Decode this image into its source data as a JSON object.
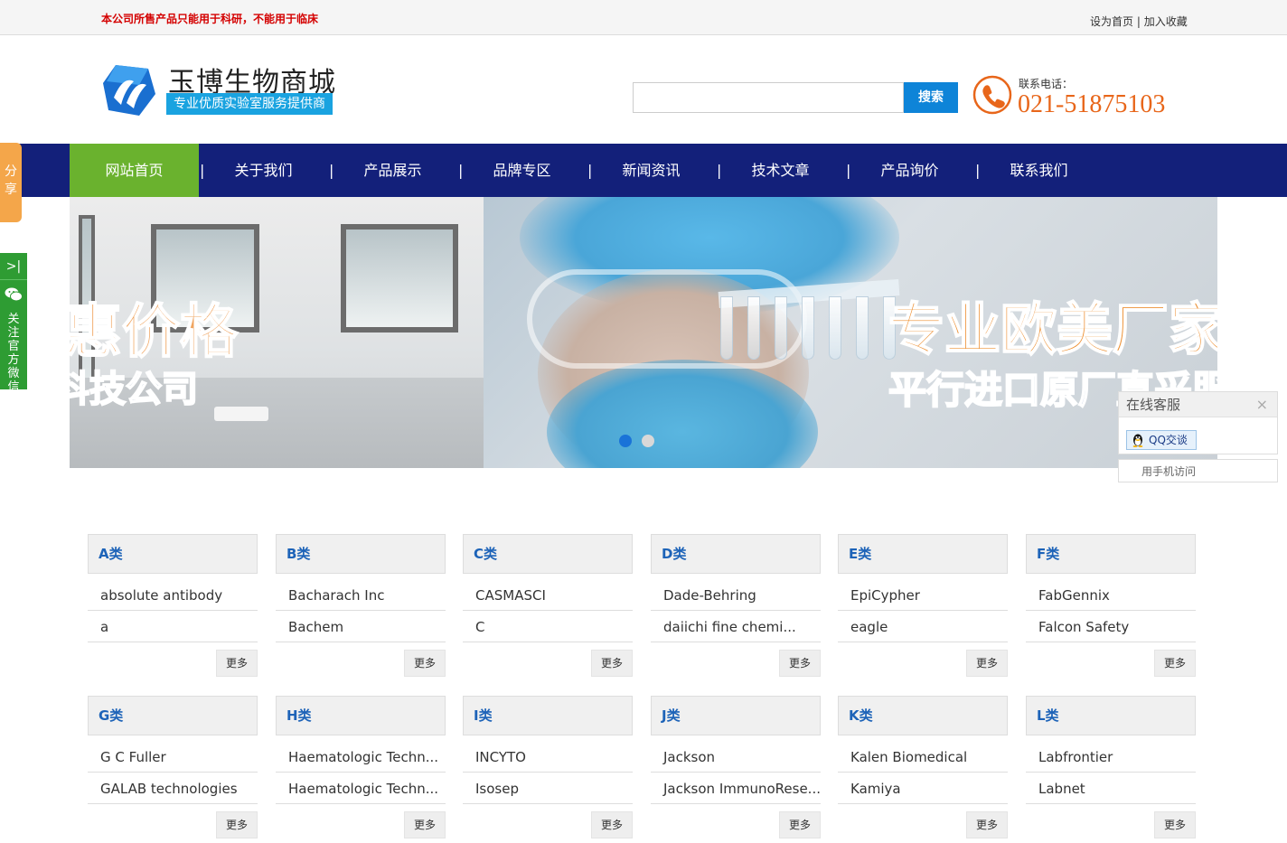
{
  "topbar": {
    "notice": "本公司所售产品只能用于科研，不能用于临床",
    "set_home": "设为首页",
    "separator": "|",
    "add_favorite": "加入收藏"
  },
  "header": {
    "logo_title": "玉博生物商城",
    "logo_slogan": "专业优质实验室服务提供商",
    "search_placeholder": "",
    "search_button": "搜索",
    "phone_label": "联系电话：",
    "phone_number": "021-51875103"
  },
  "nav": {
    "items": [
      "网站首页",
      "关于我们",
      "产品展示",
      "品牌专区",
      "新闻资讯",
      "技术文章",
      "产品询价",
      "联系我们"
    ],
    "separator": "|",
    "active_index": 0
  },
  "banner": {
    "left_line1": "惠价格",
    "left_line2": "科技公司",
    "right_line1": "专业欧美厂家",
    "right_line2": "平行进口原厂直采服",
    "slide_count": 2,
    "active_slide": 0
  },
  "sidebar": {
    "share_label": "分享",
    "wechat_arrow": ">|",
    "wechat_label": "关注官方微信"
  },
  "customer_service": {
    "title": "在线客服",
    "close": "×",
    "qq_button": "QQ交谈",
    "mobile_link": "用手机访问"
  },
  "categories": [
    {
      "title": "A类",
      "items": [
        "absolute antibody",
        "a"
      ],
      "more": "更多"
    },
    {
      "title": "B类",
      "items": [
        "Bacharach Inc",
        "Bachem"
      ],
      "more": "更多"
    },
    {
      "title": "C类",
      "items": [
        "CASMASCI",
        "C"
      ],
      "more": "更多"
    },
    {
      "title": "D类",
      "items": [
        "Dade-Behring",
        "daiichi fine chemi..."
      ],
      "more": "更多"
    },
    {
      "title": "E类",
      "items": [
        "EpiCypher",
        "eagle"
      ],
      "more": "更多"
    },
    {
      "title": "F类",
      "items": [
        "FabGennix",
        "Falcon Safety"
      ],
      "more": "更多"
    },
    {
      "title": "G类",
      "items": [
        "G C Fuller",
        "GALAB technologies"
      ],
      "more": "更多"
    },
    {
      "title": "H类",
      "items": [
        "Haematologic Techn...",
        "Haematologic Techn..."
      ],
      "more": "更多"
    },
    {
      "title": "I类",
      "items": [
        "INCYTO",
        "Isosep"
      ],
      "more": "更多"
    },
    {
      "title": "J类",
      "items": [
        "Jackson",
        "Jackson ImmunoRese..."
      ],
      "more": "更多"
    },
    {
      "title": "K类",
      "items": [
        "Kalen Biomedical",
        "Kamiya"
      ],
      "more": "更多"
    },
    {
      "title": "L类",
      "items": [
        "Labfrontier",
        "Labnet"
      ],
      "more": "更多"
    }
  ],
  "colors": {
    "nav_bg": "#13207a",
    "nav_active": "#6ab22e",
    "accent_blue": "#0e84d8",
    "phone_orange": "#e8661a",
    "notice_red": "#d40000",
    "category_title": "#1d63b8"
  }
}
